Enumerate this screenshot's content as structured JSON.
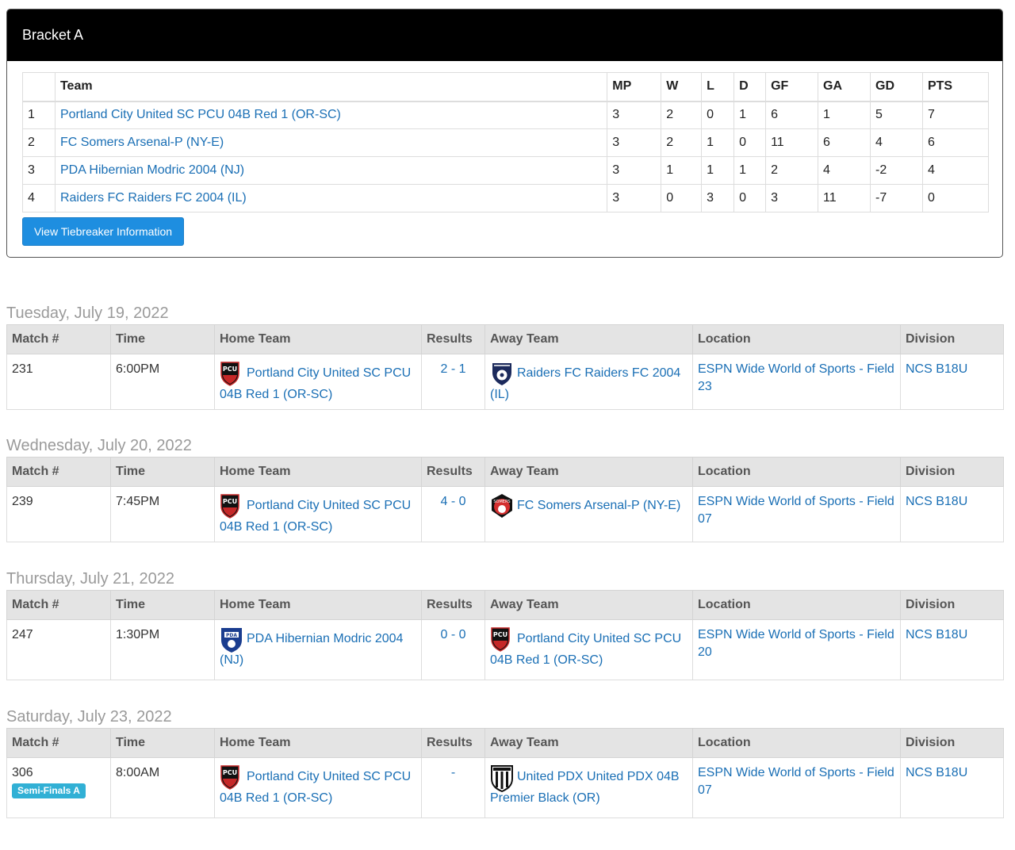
{
  "bracket": {
    "title": "Bracket A",
    "headers": [
      "",
      "Team",
      "MP",
      "W",
      "L",
      "D",
      "GF",
      "GA",
      "GD",
      "PTS"
    ],
    "rows": [
      {
        "rank": "1",
        "team": "Portland City United SC PCU 04B Red 1 (OR-SC)",
        "mp": "3",
        "w": "2",
        "l": "0",
        "d": "1",
        "gf": "6",
        "ga": "1",
        "gd": "5",
        "pts": "7"
      },
      {
        "rank": "2",
        "team": "FC Somers Arsenal-P (NY-E)",
        "mp": "3",
        "w": "2",
        "l": "1",
        "d": "0",
        "gf": "11",
        "ga": "6",
        "gd": "4",
        "pts": "6"
      },
      {
        "rank": "3",
        "team": "PDA Hibernian Modric 2004 (NJ)",
        "mp": "3",
        "w": "1",
        "l": "1",
        "d": "1",
        "gf": "2",
        "ga": "4",
        "gd": "-2",
        "pts": "4"
      },
      {
        "rank": "4",
        "team": "Raiders FC Raiders FC 2004 (IL)",
        "mp": "3",
        "w": "0",
        "l": "3",
        "d": "0",
        "gf": "3",
        "ga": "11",
        "gd": "-7",
        "pts": "0"
      }
    ],
    "tiebreaker_button": "View Tiebreaker Information"
  },
  "schedule_headers": {
    "match": "Match #",
    "time": "Time",
    "home": "Home Team",
    "results": "Results",
    "away": "Away Team",
    "location": "Location",
    "division": "Division"
  },
  "days": [
    {
      "date": "Tuesday, July 19, 2022",
      "match": {
        "number": "231",
        "badge": "",
        "time": "6:00PM",
        "home": "Portland City United SC PCU 04B Red 1 (OR-SC)",
        "home_icon": "pcu-crest-icon",
        "result": "2 - 1",
        "away": "Raiders FC Raiders FC 2004 (IL)",
        "away_icon": "raiders-crest-icon",
        "location": "ESPN Wide World of Sports - Field 23",
        "division": "NCS B18U"
      }
    },
    {
      "date": "Wednesday, July 20, 2022",
      "match": {
        "number": "239",
        "badge": "",
        "time": "7:45PM",
        "home": "Portland City United SC PCU 04B Red 1 (OR-SC)",
        "home_icon": "pcu-crest-icon",
        "result": "4 - 0",
        "away": "FC Somers Arsenal-P (NY-E)",
        "away_icon": "somers-crest-icon",
        "location": "ESPN Wide World of Sports - Field 07",
        "division": "NCS B18U"
      }
    },
    {
      "date": "Thursday, July 21, 2022",
      "match": {
        "number": "247",
        "badge": "",
        "time": "1:30PM",
        "home": "PDA Hibernian Modric 2004 (NJ)",
        "home_icon": "pda-crest-icon",
        "result": "0 - 0",
        "away": "Portland City United SC PCU 04B Red 1 (OR-SC)",
        "away_icon": "pcu-crest-icon",
        "location": "ESPN Wide World of Sports - Field 20",
        "division": "NCS B18U"
      }
    },
    {
      "date": "Saturday, July 23, 2022",
      "match": {
        "number": "306",
        "badge": "Semi-Finals A",
        "time": "8:00AM",
        "home": "Portland City United SC PCU 04B Red 1 (OR-SC)",
        "home_icon": "pcu-crest-icon",
        "result": "-",
        "away": "United PDX United PDX 04B Premier Black (OR)",
        "away_icon": "united-pdx-crest-icon",
        "location": "ESPN Wide World of Sports - Field 07",
        "division": "NCS B18U"
      }
    }
  ],
  "colors": {
    "link": "#1a6fb5",
    "button": "#1e8ee0",
    "badge": "#31b0d5",
    "header_bg": "#000000"
  }
}
